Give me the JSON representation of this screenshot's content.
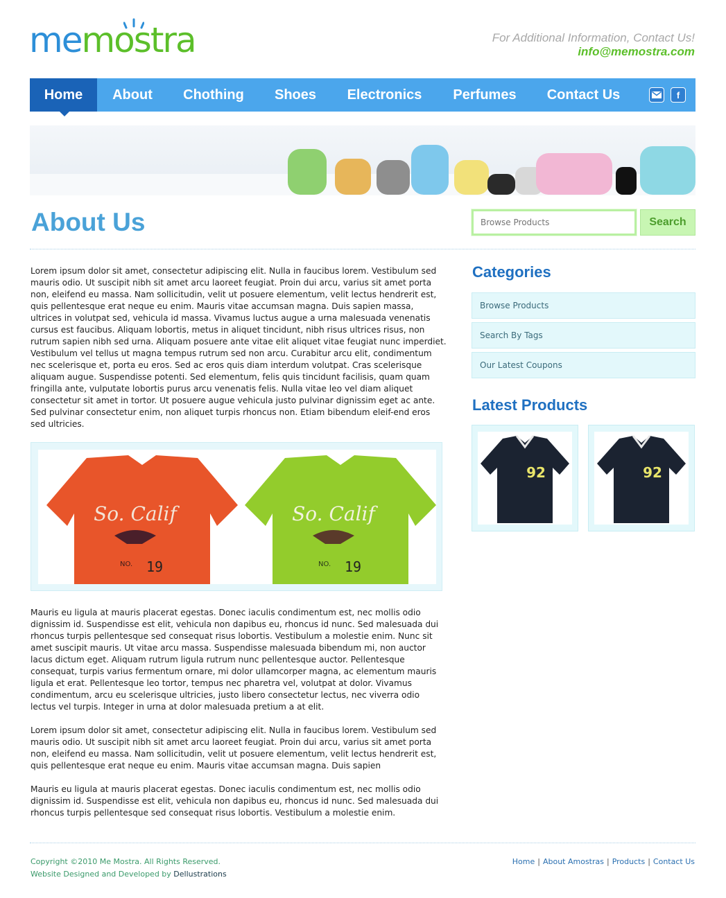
{
  "brand": {
    "logo_me": "me",
    "logo_mostra": "mostra",
    "contact_line": "For Additional Information, Contact Us!",
    "contact_email": "info@memostra.com"
  },
  "nav": {
    "items": [
      {
        "label": "Home"
      },
      {
        "label": "About"
      },
      {
        "label": "Chothing"
      },
      {
        "label": "Shoes"
      },
      {
        "label": "Electronics"
      },
      {
        "label": "Perfumes"
      },
      {
        "label": "Contact Us"
      }
    ],
    "active": "Home",
    "social": [
      {
        "icon": "mail-icon"
      },
      {
        "icon": "facebook-icon",
        "glyph": "f"
      }
    ]
  },
  "page": {
    "title": "About Us",
    "paragraphs": [
      "Lorem ipsum dolor sit amet, consectetur adipiscing elit. Nulla in faucibus lorem. Vestibulum sed mauris odio. Ut suscipit nibh sit amet arcu laoreet feugiat. Proin dui arcu, varius sit amet porta non, eleifend eu massa. Nam sollicitudin, velit ut posuere elementum, velit lectus hendrerit est, quis pellentesque erat neque eu enim. Mauris vitae accumsan magna. Duis sapien massa, ultrices in volutpat sed, vehicula id massa. Vivamus luctus augue a urna malesuada venenatis cursus est faucibus. Aliquam lobortis, metus in aliquet tincidunt, nibh risus ultrices risus, non rutrum sapien nibh sed urna. Aliquam posuere ante vitae elit aliquet vitae feugiat nunc imperdiet. Vestibulum vel tellus ut magna tempus rutrum sed non arcu. Curabitur arcu elit, condimentum nec scelerisque et, porta eu eros. Sed ac eros quis diam interdum volutpat. Cras scelerisque aliquam augue. Suspendisse potenti. Sed elementum, felis quis tincidunt facilisis, quam quam fringilla ante, vulputate lobortis purus arcu venenatis felis. Nulla vitae leo vel diam aliquet consectetur sit amet in tortor. Ut posuere augue vehicula justo pulvinar dignissim eget ac ante. Sed pulvinar consectetur enim, non aliquet turpis rhoncus non. Etiam bibendum eleif-end eros sed ultricies.",
      "Mauris eu ligula at mauris placerat egestas. Donec iaculis condimentum est, nec mollis odio dignissim id. Suspendisse est elit, vehicula non dapibus eu, rhoncus id nunc. Sed malesuada dui rhoncus turpis pellentesque sed consequat risus lobortis. Vestibulum a molestie enim. Nunc sit amet suscipit mauris. Ut vitae arcu massa. Suspendisse malesuada bibendum mi, non auctor lacus dictum eget. Aliquam rutrum ligula rutrum nunc pellentesque auctor. Pellentesque consequat, turpis varius fermentum ornare, mi dolor ullamcorper magna, ac elementum mauris ligula et erat. Pellentesque leo tortor, tempus nec pharetra vel, volutpat at dolor. Vivamus condimentum, arcu eu scelerisque ultricies, justo libero consectetur lectus, nec viverra odio lectus vel turpis. Integer in urna at dolor malesuada pretium a at elit.",
      "Lorem ipsum dolor sit amet, consectetur adipiscing elit. Nulla in faucibus lorem. Vestibulum sed mauris odio. Ut suscipit nibh sit amet arcu laoreet feugiat. Proin dui arcu, varius sit amet porta non, eleifend eu massa. Nam sollicitudin, velit ut posuere elementum, velit lectus hendrerit est, quis pellentesque erat neque eu enim. Mauris vitae accumsan magna. Duis sapien",
      "Mauris eu ligula at mauris placerat egestas. Donec iaculis condimentum est, nec mollis odio dignissim id. Suspendisse est elit, vehicula non dapibus eu, rhoncus id nunc. Sed malesuada dui rhoncus turpis pellentesque sed consequat risus lobortis. Vestibulum a molestie enim."
    ],
    "figure": {
      "shirts": [
        {
          "color": "#e8552a",
          "print": "So. Calif",
          "number": "19",
          "label": "NO."
        },
        {
          "color": "#93cc2c",
          "print": "So. Calif",
          "number": "19",
          "label": "NO."
        }
      ]
    }
  },
  "search": {
    "placeholder": "Browse Products",
    "button_label": "Search"
  },
  "sidebar": {
    "categories_title": "Categories",
    "categories": [
      {
        "label": "Browse Products"
      },
      {
        "label": "Search By Tags"
      },
      {
        "label": "Our Latest Coupons"
      }
    ],
    "latest_title": "Latest Products",
    "products": [
      {
        "number": "92",
        "color": "#1b2331"
      },
      {
        "number": "92",
        "color": "#1b2331"
      }
    ]
  },
  "footer": {
    "copyright": "Copyright ©2010 Me Mostra. All Rights Reserved.",
    "credit_prefix": "Website Designed and Developed by",
    "credit_name": "Dellustrations",
    "links": [
      {
        "label": "Home"
      },
      {
        "label": "About Amostras"
      },
      {
        "label": "Products"
      },
      {
        "label": "Contact Us"
      }
    ],
    "separator": "|"
  }
}
